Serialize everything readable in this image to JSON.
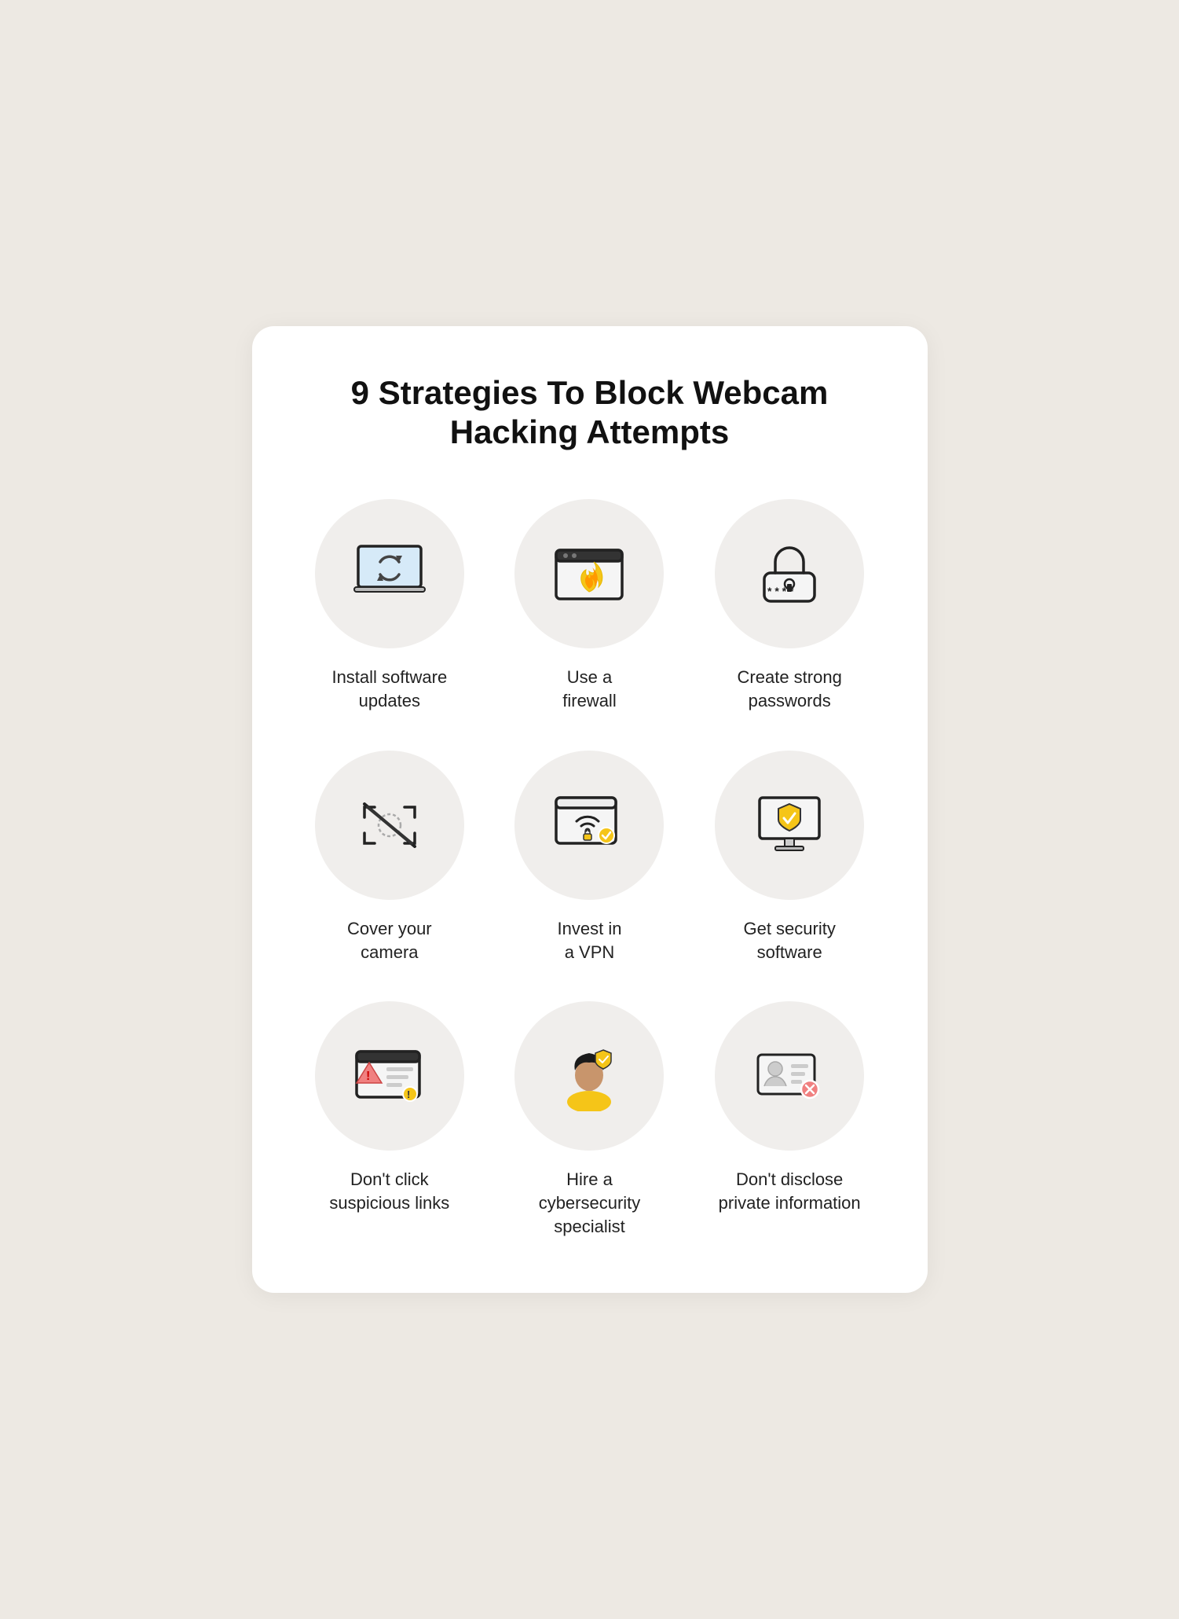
{
  "page": {
    "title": "9 Strategies To Block Webcam Hacking Attempts",
    "background_color": "#ede9e3",
    "card_background": "#ffffff"
  },
  "strategies": [
    {
      "id": "install-updates",
      "label": "Install software updates",
      "icon": "laptop-update-icon"
    },
    {
      "id": "use-firewall",
      "label": "Use a firewall",
      "icon": "firewall-icon"
    },
    {
      "id": "strong-passwords",
      "label": "Create strong passwords",
      "icon": "password-icon"
    },
    {
      "id": "cover-camera",
      "label": "Cover your camera",
      "icon": "camera-cover-icon"
    },
    {
      "id": "invest-vpn",
      "label": "Invest in a VPN",
      "icon": "vpn-icon"
    },
    {
      "id": "security-software",
      "label": "Get security software",
      "icon": "security-software-icon"
    },
    {
      "id": "suspicious-links",
      "label": "Don't click suspicious links",
      "icon": "suspicious-links-icon"
    },
    {
      "id": "cybersecurity-specialist",
      "label": "Hire a cybersecurity specialist",
      "icon": "cybersecurity-specialist-icon"
    },
    {
      "id": "private-information",
      "label": "Don't disclose private information",
      "icon": "private-info-icon"
    }
  ]
}
